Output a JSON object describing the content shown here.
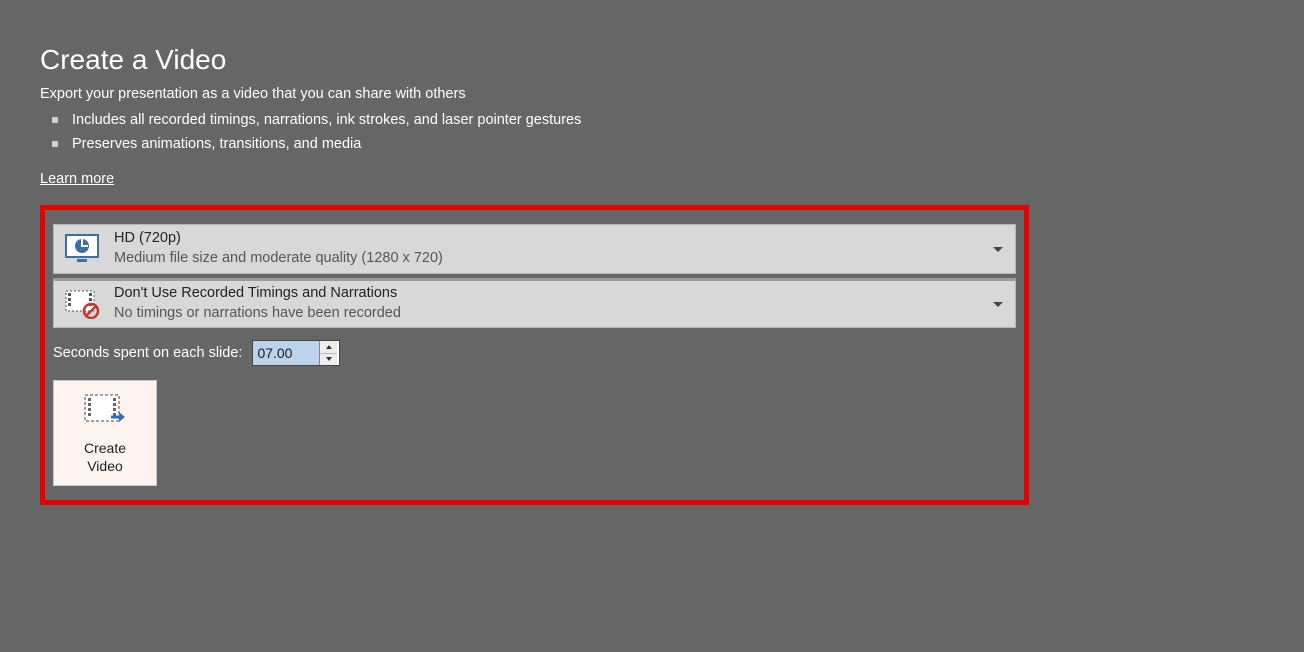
{
  "header": {
    "title": "Create a Video",
    "subtitle": "Export your presentation as a video that you can share with others",
    "bullets": [
      "Includes all recorded timings, narrations, ink strokes, and laser pointer gestures",
      "Preserves animations, transitions, and media"
    ],
    "learn_more": "Learn more"
  },
  "quality": {
    "title": "HD (720p)",
    "desc": "Medium file size and moderate quality (1280 x 720)"
  },
  "timings": {
    "title": "Don't Use Recorded Timings and Narrations",
    "desc": "No timings or narrations have been recorded"
  },
  "seconds": {
    "label": "Seconds spent on each slide:",
    "value": "07.00"
  },
  "create_button": {
    "line1": "Create",
    "line2": "Video"
  }
}
